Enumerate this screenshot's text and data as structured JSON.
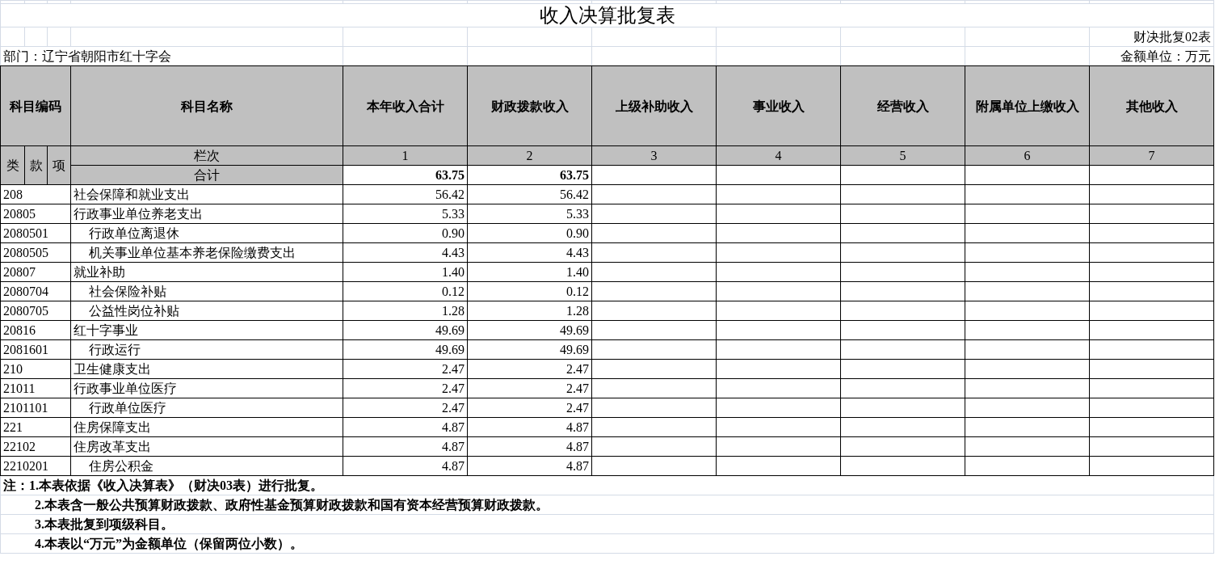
{
  "title": "收入决算批复表",
  "form_no": "财决批复02表",
  "department": "部门：辽宁省朝阳市红十字会",
  "unit": "金额单位：万元",
  "table": {
    "code_header": "科目编码",
    "name_header": "科目名称",
    "columns": [
      "本年收入合计",
      "财政拨款收入",
      "上级补助收入",
      "事业收入",
      "经营收入",
      "附属单位上缴收入",
      "其他收入"
    ],
    "code_levels": [
      "类",
      "款",
      "项"
    ],
    "index_label": "栏次",
    "column_numbers": [
      "1",
      "2",
      "3",
      "4",
      "5",
      "6",
      "7"
    ],
    "total": {
      "label": "合计",
      "values": [
        "63.75",
        "63.75"
      ]
    },
    "rows": [
      {
        "code": "208",
        "name": "社会保障和就业支出",
        "values": [
          "56.42",
          "56.42"
        ],
        "children": [
          {
            "code": "20805",
            "name": "行政事业单位养老支出",
            "values": [
              "5.33",
              "5.33"
            ],
            "children": [
              {
                "code": "2080501",
                "name": "行政单位离退休",
                "values": [
                  "0.90",
                  "0.90"
                ]
              },
              {
                "code": "2080505",
                "name": "机关事业单位基本养老保险缴费支出",
                "values": [
                  "4.43",
                  "4.43"
                ]
              }
            ]
          },
          {
            "code": "20807",
            "name": "就业补助",
            "values": [
              "1.40",
              "1.40"
            ],
            "children": [
              {
                "code": "2080704",
                "name": "社会保险补贴",
                "values": [
                  "0.12",
                  "0.12"
                ]
              },
              {
                "code": "2080705",
                "name": "公益性岗位补贴",
                "values": [
                  "1.28",
                  "1.28"
                ]
              }
            ]
          },
          {
            "code": "20816",
            "name": "红十字事业",
            "values": [
              "49.69",
              "49.69"
            ],
            "children": [
              {
                "code": "2081601",
                "name": "行政运行",
                "values": [
                  "49.69",
                  "49.69"
                ]
              }
            ]
          }
        ]
      },
      {
        "code": "210",
        "name": "卫生健康支出",
        "values": [
          "2.47",
          "2.47"
        ],
        "children": [
          {
            "code": "21011",
            "name": "行政事业单位医疗",
            "values": [
              "2.47",
              "2.47"
            ],
            "children": [
              {
                "code": "2101101",
                "name": "行政单位医疗",
                "values": [
                  "2.47",
                  "2.47"
                ]
              }
            ]
          }
        ]
      },
      {
        "code": "221",
        "name": "住房保障支出",
        "values": [
          "4.87",
          "4.87"
        ],
        "children": [
          {
            "code": "22102",
            "name": "住房改革支出",
            "values": [
              "4.87",
              "4.87"
            ],
            "children": [
              {
                "code": "2210201",
                "name": "住房公积金",
                "values": [
                  "4.87",
                  "4.87"
                ]
              }
            ]
          }
        ]
      }
    ]
  },
  "notes": [
    "注：1.本表依据《收入决算表》（财决03表）进行批复。",
    "2.本表含一般公共预算财政拨款、政府性基金预算财政拨款和国有资本经营预算财政拨款。",
    "3.本表批复到项级科目。",
    "4.本表以“万元”为金额单位（保留两位小数）。"
  ]
}
